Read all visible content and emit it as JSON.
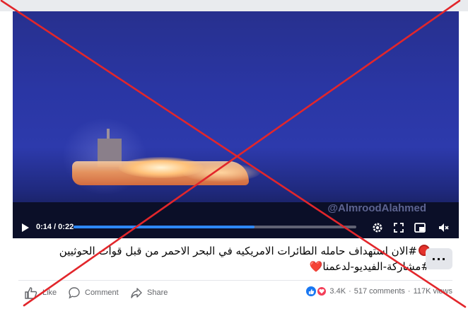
{
  "video": {
    "watermark": "@AlmroodAlahmed",
    "time": "0:14 / 0:22",
    "progress": 0.64
  },
  "post": {
    "caption_line1": "#الان استهداف حامله الطائرات الامريكيه في البحر الاحمر من قبل قوات الحوثيين",
    "caption_line2": "#مشاركة-الفيديو-لدعمنا",
    "heart": "❤️",
    "more_label": "···"
  },
  "actions": {
    "like": "Like",
    "comment": "Comment",
    "share": "Share"
  },
  "stats": {
    "reactions": "3.4K",
    "comments": "517 comments",
    "views": "117K views",
    "separator": "·"
  },
  "colors": {
    "overlay_cross": "#e2262b",
    "progress": "#2d88ff",
    "like_reaction": "#1877f2",
    "love_reaction": "#f33e58"
  },
  "icons": {
    "play": "play-icon",
    "settings": "gear-icon",
    "fullscreen": "expand-icon",
    "pip": "picture-in-picture-icon",
    "volume": "volume-icon",
    "like": "thumbs-up-icon",
    "comment": "speech-bubble-icon",
    "share": "share-arrow-icon"
  }
}
